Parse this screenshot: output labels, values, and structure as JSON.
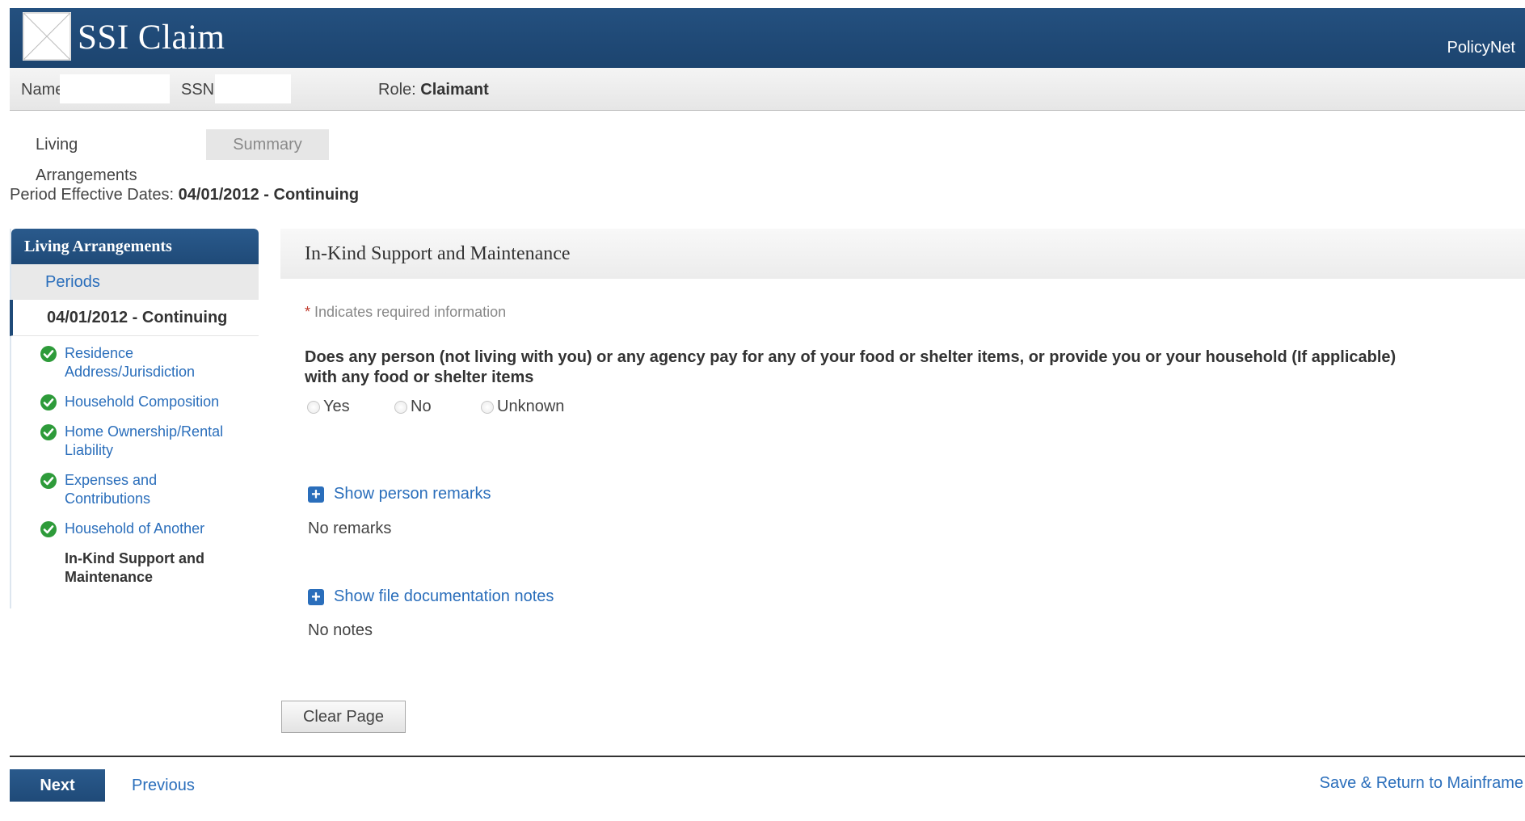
{
  "header": {
    "title": "SSI Claim",
    "right_link": "PolicyNet"
  },
  "infobar": {
    "name_label": "Name:",
    "ssn_label": "SSN:",
    "role_label": "Role:",
    "role_value": "Claimant"
  },
  "tabs": [
    {
      "label": "Living Arrangements"
    },
    {
      "label": "Summary"
    }
  ],
  "period": {
    "label": "Period Effective Dates:",
    "value": "04/01/2012 - Continuing"
  },
  "sidebar": {
    "heading": "Living Arrangements",
    "periods_link": "Periods",
    "current_period": "04/01/2012 - Continuing",
    "items": [
      {
        "label": "Residence Address/Jurisdiction",
        "status": "complete"
      },
      {
        "label": "Household Composition",
        "status": "complete"
      },
      {
        "label": "Home Ownership/Rental Liability",
        "status": "complete"
      },
      {
        "label": "Expenses and Contributions",
        "status": "complete"
      },
      {
        "label": "Household of Another",
        "status": "complete"
      },
      {
        "label": "In-Kind Support and Maintenance",
        "status": "current"
      }
    ]
  },
  "main": {
    "title": "In-Kind Support and Maintenance",
    "required_note": "Indicates required information",
    "question": "Does any person (not living with you) or any agency pay for any of your food or shelter items, or provide you or your household (If applicable) with any food or shelter items",
    "options": [
      "Yes",
      "No",
      "Unknown"
    ],
    "person_remarks_link": "Show person remarks",
    "person_remarks_value": "No remarks",
    "file_notes_link": "Show file documentation notes",
    "file_notes_value": "No notes",
    "clear_button": "Clear Page"
  },
  "footer": {
    "next": "Next",
    "previous": "Previous",
    "save_return": "Save & Return to Mainframe"
  },
  "colors": {
    "header_blue": "#1f4a78",
    "link_blue": "#2a6ebb",
    "check_green": "#2e9b3a"
  }
}
